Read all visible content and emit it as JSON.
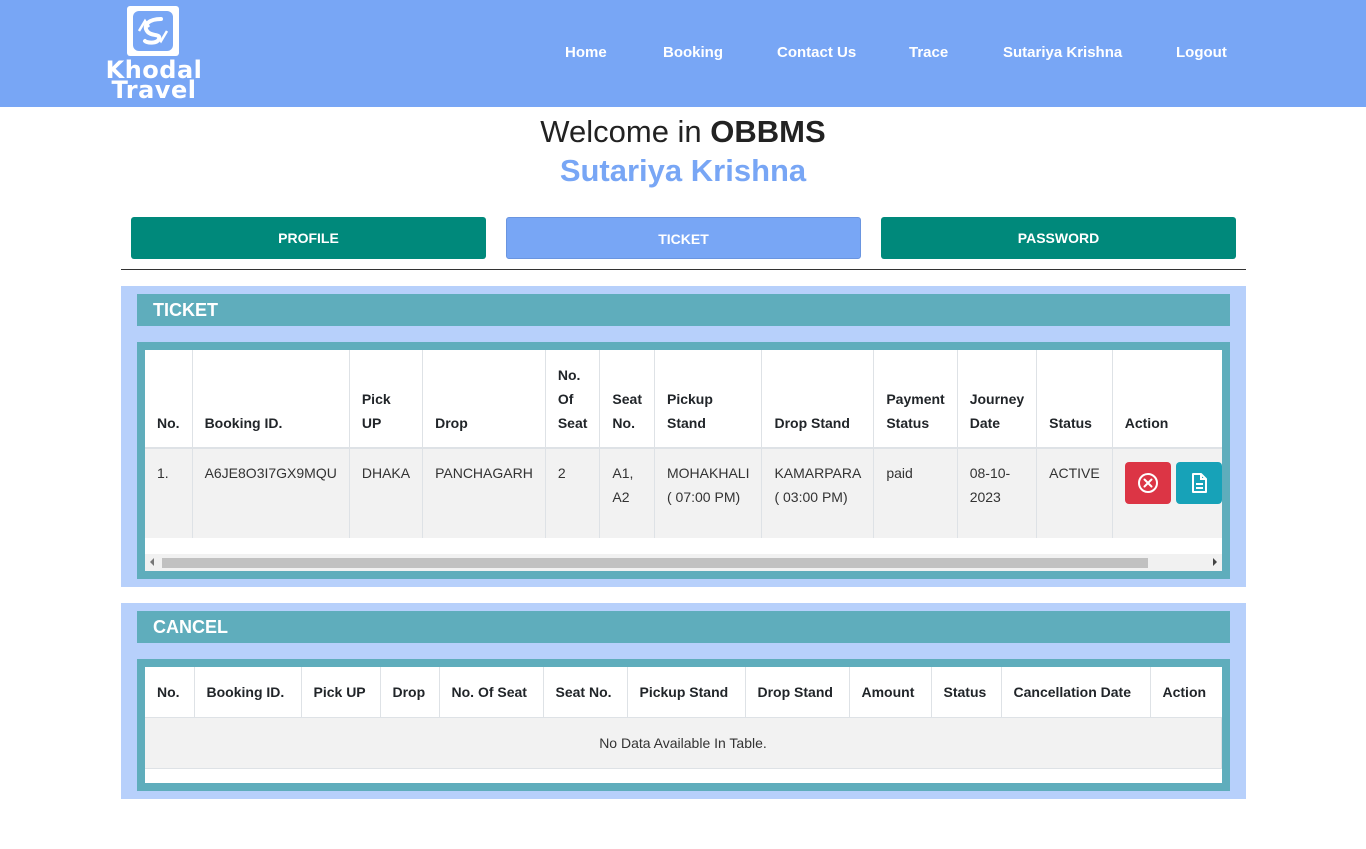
{
  "brand": {
    "line1": "Khodal",
    "line2": "Travel"
  },
  "nav": [
    {
      "label": "Home"
    },
    {
      "label": "Booking"
    },
    {
      "label": "Contact Us"
    },
    {
      "label": "Trace"
    },
    {
      "label": "Sutariya Krishna"
    },
    {
      "label": "Logout"
    }
  ],
  "welcome": {
    "prefix": "Welcome in",
    "app": "OBBMS",
    "user": "Sutariya Krishna"
  },
  "tabs": [
    {
      "label": "PROFILE"
    },
    {
      "label": "TICKET"
    },
    {
      "label": "PASSWORD"
    }
  ],
  "ticket": {
    "title": "TICKET",
    "columns": [
      [
        "No."
      ],
      [
        "Booking ID."
      ],
      [
        "Pick",
        "UP"
      ],
      [
        "Drop"
      ],
      [
        "No.",
        "Of",
        "Seat"
      ],
      [
        "Seat",
        "No."
      ],
      [
        "Pickup",
        "Stand"
      ],
      [
        "Drop Stand"
      ],
      [
        "Payment",
        "Status"
      ],
      [
        "Journey",
        "Date"
      ],
      [
        "Status"
      ],
      [
        "Action"
      ]
    ],
    "rows": [
      {
        "no": "1.",
        "booking_id": "A6JE8O3I7GX9MQU",
        "pick_up": "DHAKA",
        "drop": "PANCHAGARH",
        "seats": "2",
        "seat_no": [
          "A1,",
          "A2"
        ],
        "pickup_stand": [
          "MOHAKHALI",
          "( 07:00 PM)"
        ],
        "drop_stand": [
          "KAMARPARA",
          "( 03:00 PM)"
        ],
        "payment_status": "paid",
        "journey_date": [
          "08-10-",
          "2023"
        ],
        "status": "ACTIVE"
      }
    ]
  },
  "cancel": {
    "title": "CANCEL",
    "columns": [
      "No.",
      "Booking ID.",
      "Pick UP",
      "Drop",
      "No. Of Seat",
      "Seat No.",
      "Pickup Stand",
      "Drop Stand",
      "Amount",
      "Status",
      "Cancellation Date",
      "Action"
    ],
    "empty_message": "No Data Available In Table."
  }
}
